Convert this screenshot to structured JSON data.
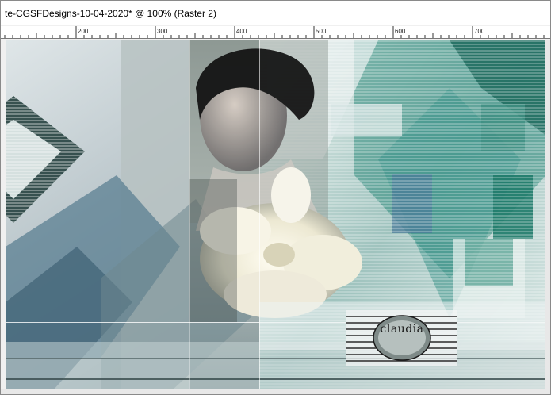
{
  "window": {
    "title": "te-CGSFDesigns-10-04-2020* @ 100% (Raster 2)"
  },
  "ruler": {
    "labels": [
      "200",
      "300",
      "400",
      "500",
      "600",
      "700"
    ]
  },
  "canvas": {
    "watermark_text": "claudia"
  },
  "colors": {
    "teal_dark": "#1e6b5e",
    "teal_mid": "#3e8f86",
    "slate": "#5c6e78",
    "pale": "#dfe9e8",
    "cream_flower": "#f4f1e3"
  }
}
